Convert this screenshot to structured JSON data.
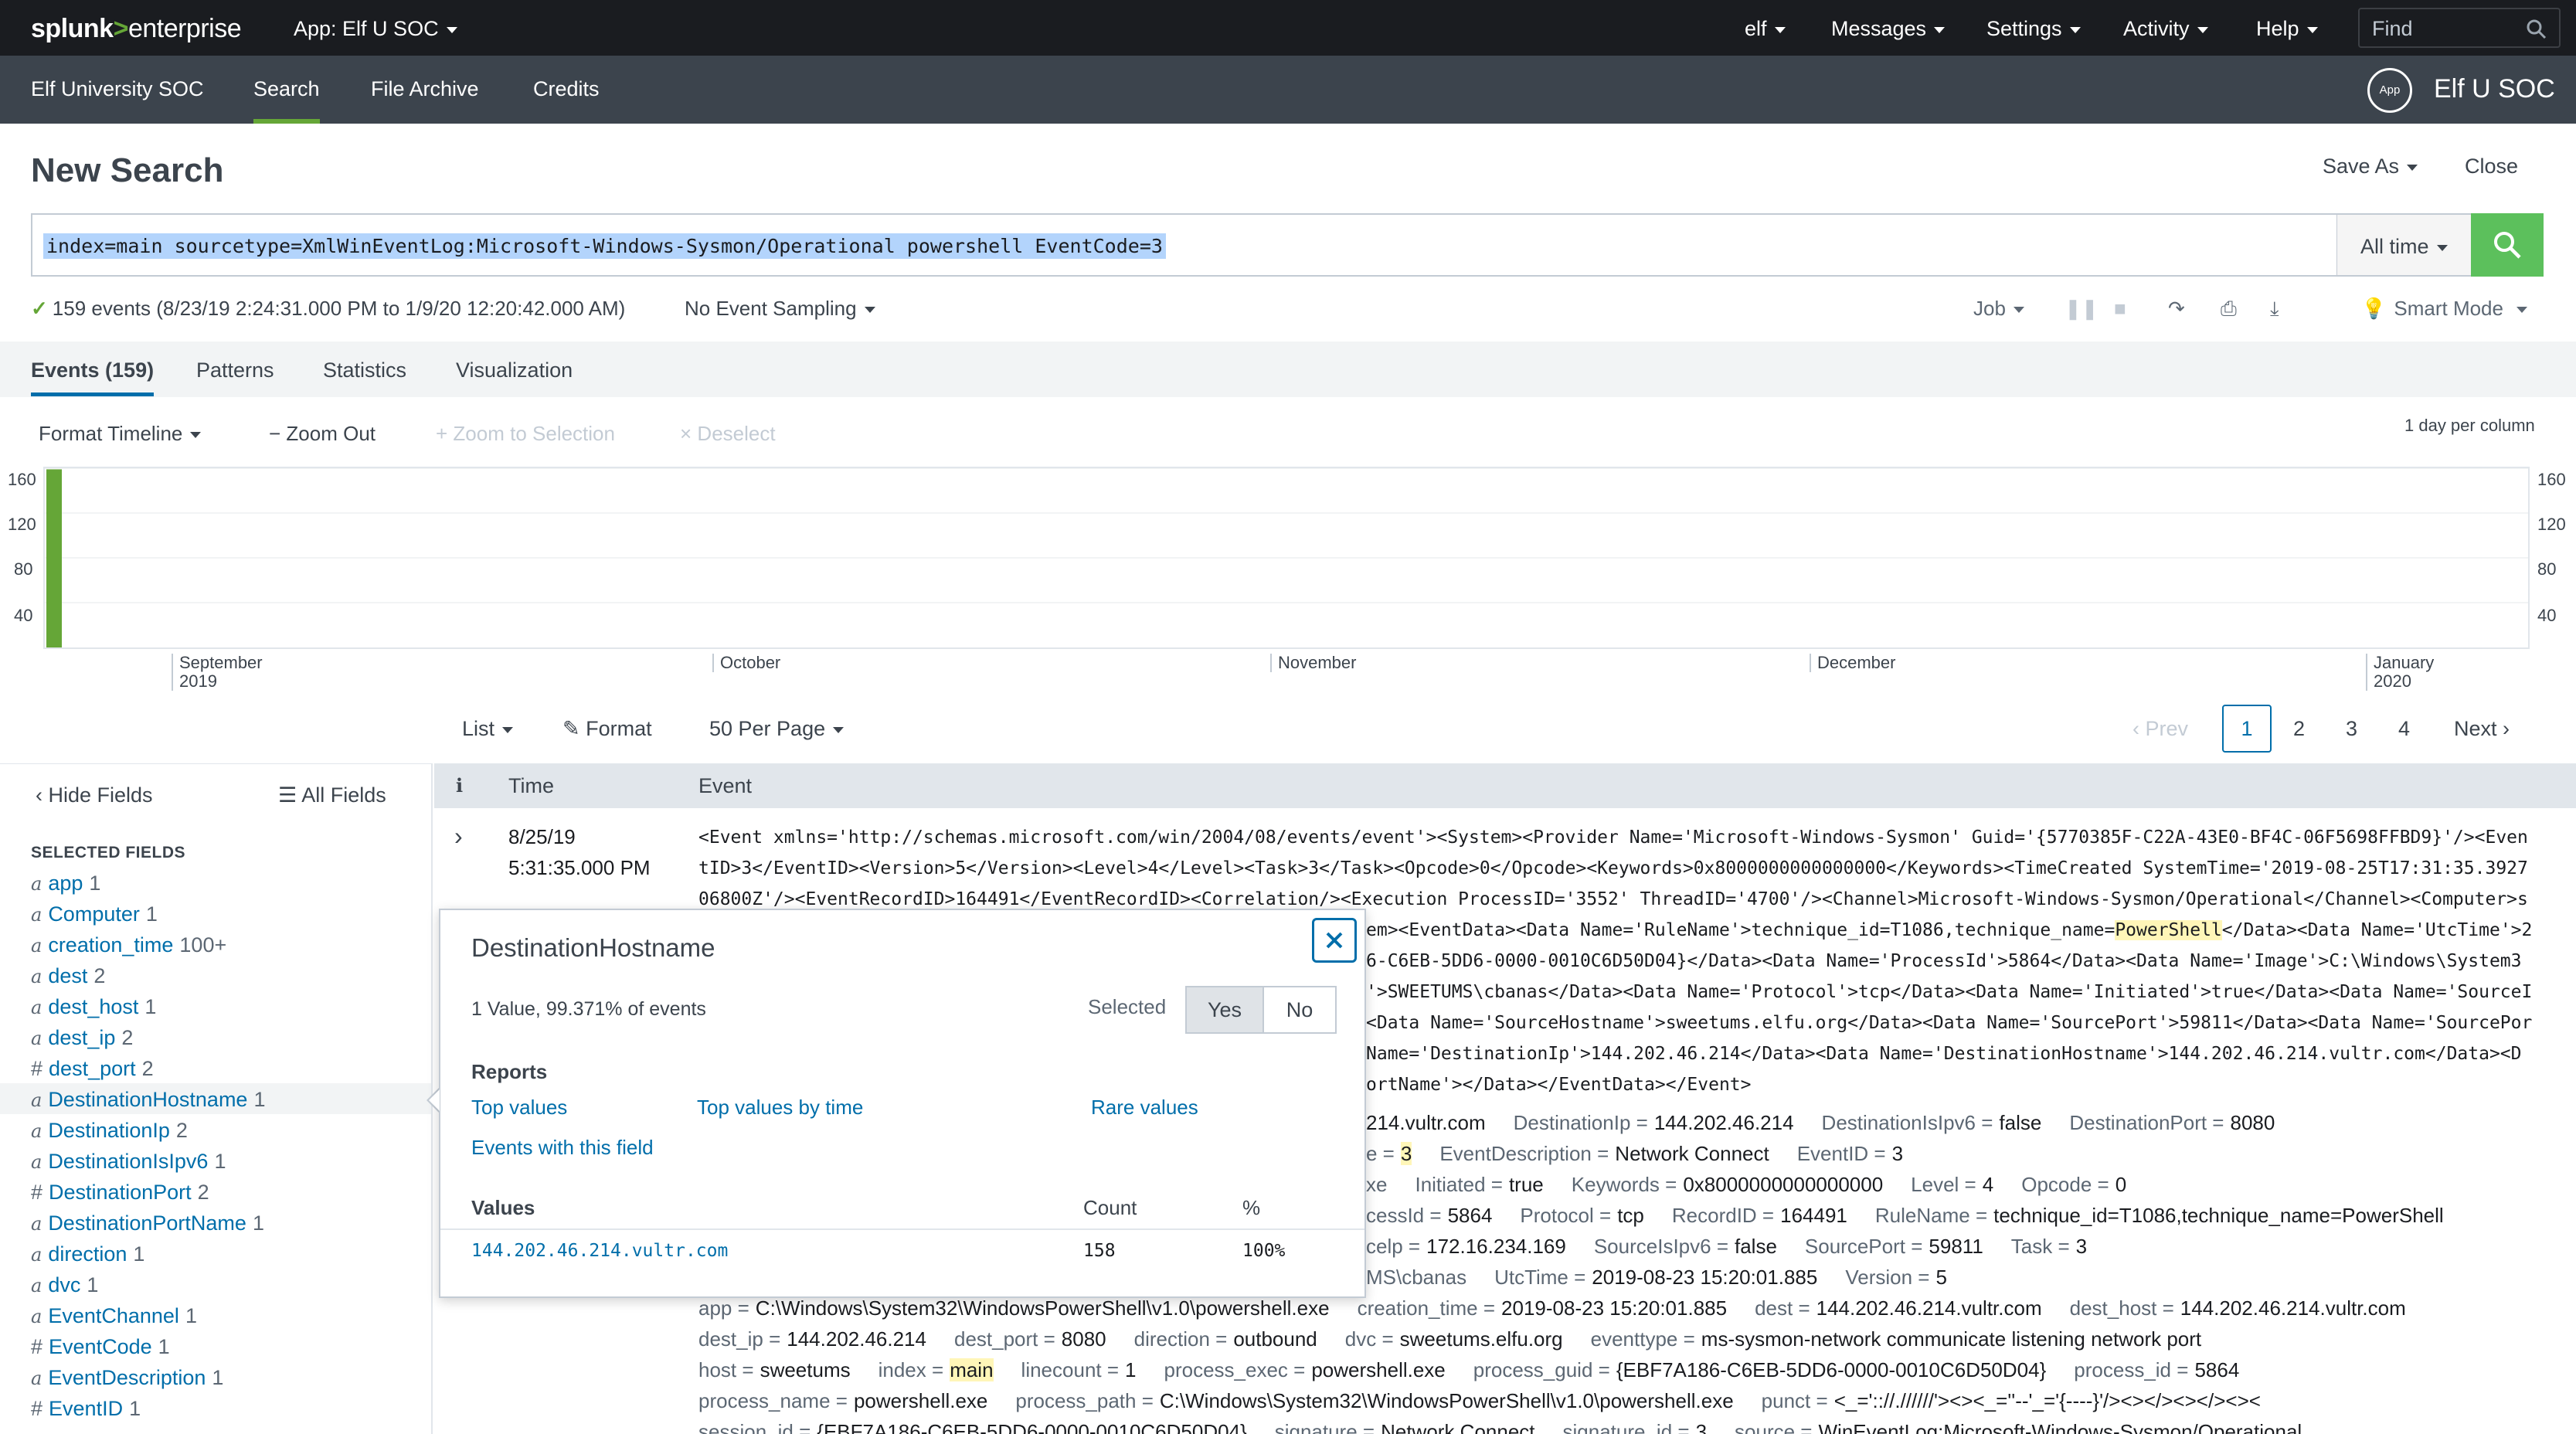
{
  "topbar": {
    "logo_main": "splunk",
    "logo_gt": ">",
    "logo_product": "enterprise",
    "app_menu": "App: Elf U SOC",
    "menus": [
      "elf",
      "Messages",
      "Settings",
      "Activity",
      "Help"
    ],
    "find_placeholder": "Find"
  },
  "appbar": {
    "nav": [
      "Elf University SOC",
      "Search",
      "File Archive",
      "Credits"
    ],
    "badge": "App",
    "app_name": "Elf U SOC"
  },
  "search": {
    "title": "New Search",
    "save_as": "Save As",
    "close": "Close",
    "query": "index=main sourcetype=XmlWinEventLog:Microsoft-Windows-Sysmon/Operational powershell EventCode=3",
    "time_range": "All time",
    "status": "159 events (8/23/19 2:24:31.000 PM to 1/9/20 12:20:42.000 AM)",
    "sampling": "No Event Sampling",
    "job": "Job",
    "mode": "Smart Mode"
  },
  "tabs": [
    "Events (159)",
    "Patterns",
    "Statistics",
    "Visualization"
  ],
  "timeline_controls": {
    "format": "Format Timeline",
    "zoom_out": "Zoom Out",
    "zoom_sel": "Zoom to Selection",
    "deselect": "Deselect",
    "per_column": "1 day per column"
  },
  "chart_data": {
    "type": "bar",
    "y_ticks": [
      160,
      120,
      80,
      40
    ],
    "ylim": [
      0,
      160
    ],
    "x_labels": [
      {
        "month": "September",
        "year": "2019"
      },
      {
        "month": "October",
        "year": ""
      },
      {
        "month": "November",
        "year": ""
      },
      {
        "month": "December",
        "year": ""
      },
      {
        "month": "January",
        "year": "2020"
      }
    ],
    "bars": [
      {
        "date": "8/23/19",
        "value": 159
      }
    ],
    "bar_color": "#65a637"
  },
  "list_controls": {
    "list": "List",
    "format": "Format",
    "per_page": "50 Per Page",
    "prev": "Prev",
    "pages": [
      "1",
      "2",
      "3",
      "4"
    ],
    "next": "Next"
  },
  "sidebar": {
    "hide_fields": "Hide Fields",
    "all_fields": "All Fields",
    "selected_header": "SELECTED FIELDS",
    "fields": [
      {
        "type": "a",
        "name": "app",
        "count": "1"
      },
      {
        "type": "a",
        "name": "Computer",
        "count": "1"
      },
      {
        "type": "a",
        "name": "creation_time",
        "count": "100+"
      },
      {
        "type": "a",
        "name": "dest",
        "count": "2"
      },
      {
        "type": "a",
        "name": "dest_host",
        "count": "1"
      },
      {
        "type": "a",
        "name": "dest_ip",
        "count": "2"
      },
      {
        "type": "#",
        "name": "dest_port",
        "count": "2"
      },
      {
        "type": "a",
        "name": "DestinationHostname",
        "count": "1"
      },
      {
        "type": "a",
        "name": "DestinationIp",
        "count": "2"
      },
      {
        "type": "a",
        "name": "DestinationIsIpv6",
        "count": "1"
      },
      {
        "type": "#",
        "name": "DestinationPort",
        "count": "2"
      },
      {
        "type": "a",
        "name": "DestinationPortName",
        "count": "1"
      },
      {
        "type": "a",
        "name": "direction",
        "count": "1"
      },
      {
        "type": "a",
        "name": "dvc",
        "count": "1"
      },
      {
        "type": "a",
        "name": "EventChannel",
        "count": "1"
      },
      {
        "type": "#",
        "name": "EventCode",
        "count": "1"
      },
      {
        "type": "a",
        "name": "EventDescription",
        "count": "1"
      },
      {
        "type": "#",
        "name": "EventID",
        "count": "1"
      }
    ]
  },
  "events_table": {
    "col_info": "i",
    "col_time": "Time",
    "col_event": "Event",
    "event_date": "8/25/19",
    "event_time": "5:31:35.000 PM",
    "raw_lines": [
      [
        "<Event xmlns='http://schemas.microsoft.com/win/2004/08/events/event'><System><Provider Name='Microsoft-Windows-Sysmon' Guid='{5770385F-C22A-43E0-BF4C-06F5698FFBD9}'/><Even"
      ],
      [
        "tID>3</EventID><Version>5</Version><Level>4</Level><Task>3</Task><Opcode>0</Opcode><Keywords>0x8000000000000000</Keywords><TimeCreated SystemTime='2019-08-25T17:31:35.3927"
      ],
      [
        "06800Z'/><EventRecordID>164491</EventRecordID><Correlation/><Execution ProcessID='3552' ThreadID='4700'/><Channel>Microsoft-Windows-Sysmon/Operational</Channel><Computer>s"
      ],
      [
        "em><EventData><Data Name='RuleName'>technique_id=T1086,technique_name=",
        "PowerShell",
        "</Data><Data Name='UtcTime'>2"
      ],
      [
        "6-C6EB-5DD6-0000-0010C6D50D04}</Data><Data Name='ProcessId'>5864</Data><Data Name='Image'>C:\\Windows\\System3"
      ],
      [
        "'>SWEETUMS\\cbanas</Data><Data Name='Protocol'>tcp</Data><Data Name='Initiated'>true</Data><Data Name='SourceI"
      ],
      [
        "<Data Name='SourceHostname'>sweetums.elfu.org</Data><Data Name='SourcePort'>59811</Data><Data Name='SourcePor"
      ],
      [
        " Name='DestinationIp'>144.202.46.214</Data><Data Name='DestinationHostname'>144.202.46.214.vultr.com</Data><D"
      ],
      [
        "ortName'></Data></EventData></Event>"
      ]
    ],
    "kv_rows": [
      [
        {
          "k": "",
          "v": "214.vultr.com"
        },
        {
          "k": "DestinationIp =",
          "v": "144.202.46.214"
        },
        {
          "k": "DestinationIsIpv6 =",
          "v": "false"
        },
        {
          "k": "DestinationPort =",
          "v": "8080"
        }
      ],
      [
        {
          "k": "e =",
          "v": "3",
          "hl": true
        },
        {
          "k": "EventDescription =",
          "v": "Network Connect"
        },
        {
          "k": "EventID =",
          "v": "3"
        }
      ],
      [
        {
          "k": "xe",
          "v": ""
        },
        {
          "k": "Initiated =",
          "v": "true"
        },
        {
          "k": "Keywords =",
          "v": "0x8000000000000000"
        },
        {
          "k": "Level =",
          "v": "4"
        },
        {
          "k": "Opcode =",
          "v": "0"
        }
      ],
      [
        {
          "k": "cessId =",
          "v": "5864"
        },
        {
          "k": "Protocol =",
          "v": "tcp"
        },
        {
          "k": "RecordID =",
          "v": "164491"
        },
        {
          "k": "RuleName =",
          "v": "technique_id=T1086,technique_name=PowerShell"
        }
      ],
      [
        {
          "k": "celp =",
          "v": "172.16.234.169"
        },
        {
          "k": "SourceIsIpv6 =",
          "v": "false"
        },
        {
          "k": "SourcePort =",
          "v": "59811"
        },
        {
          "k": "Task =",
          "v": "3"
        }
      ],
      [
        {
          "k": "MS\\cbanas",
          "v": ""
        },
        {
          "k": "UtcTime =",
          "v": "2019-08-23 15:20:01.885"
        },
        {
          "k": "Version =",
          "v": "5"
        }
      ],
      [
        {
          "k": "app =",
          "v": "C:\\Windows\\System32\\WindowsPowerShell\\v1.0\\powershell.exe"
        },
        {
          "k": "creation_time =",
          "v": "2019-08-23 15:20:01.885"
        },
        {
          "k": "dest =",
          "v": "144.202.46.214.vultr.com"
        },
        {
          "k": "dest_host =",
          "v": "144.202.46.214.vultr.com"
        }
      ],
      [
        {
          "k": "dest_ip =",
          "v": "144.202.46.214"
        },
        {
          "k": "dest_port =",
          "v": "8080"
        },
        {
          "k": "direction =",
          "v": "outbound"
        },
        {
          "k": "dvc =",
          "v": "sweetums.elfu.org"
        },
        {
          "k": "eventtype =",
          "v": "ms-sysmon-network  communicate listening network port"
        }
      ],
      [
        {
          "k": "host =",
          "v": "sweetums"
        },
        {
          "k": "index =",
          "v": "main",
          "hl": true
        },
        {
          "k": "linecount =",
          "v": "1"
        },
        {
          "k": "process_exec =",
          "v": "powershell.exe"
        },
        {
          "k": "process_guid =",
          "v": "{EBF7A186-C6EB-5DD6-0000-0010C6D50D04}"
        },
        {
          "k": "process_id =",
          "v": "5864"
        }
      ],
      [
        {
          "k": "process_name =",
          "v": "powershell.exe"
        },
        {
          "k": "process_path =",
          "v": "C:\\Windows\\System32\\WindowsPowerShell\\v1.0\\powershell.exe"
        },
        {
          "k": "punct =",
          "v": "<_=':://.//////'><><_=''--'_='{----}'/><></><></><><"
        }
      ],
      [
        {
          "k": "session_id =",
          "v": "{EBF7A186-C6EB-5DD6-0000-0010C6D50D04}"
        },
        {
          "k": "signature =",
          "v": "Network Connect"
        },
        {
          "k": "signature_id =",
          "v": "3"
        },
        {
          "k": "source =",
          "v": "WinEventLog:Microsoft-Windows-Sysmon/Operational"
        }
      ]
    ]
  },
  "popup": {
    "title": "DestinationHostname",
    "summary": "1 Value, 99.371% of events",
    "selected_label": "Selected",
    "yes": "Yes",
    "no": "No",
    "reports_header": "Reports",
    "report_links": [
      "Top values",
      "Top values by time",
      "Rare values",
      "Events with this field"
    ],
    "values_header": "Values",
    "count_header": "Count",
    "pct_header": "%",
    "value": "144.202.46.214.vultr.com",
    "count": "158",
    "pct": "100%"
  }
}
